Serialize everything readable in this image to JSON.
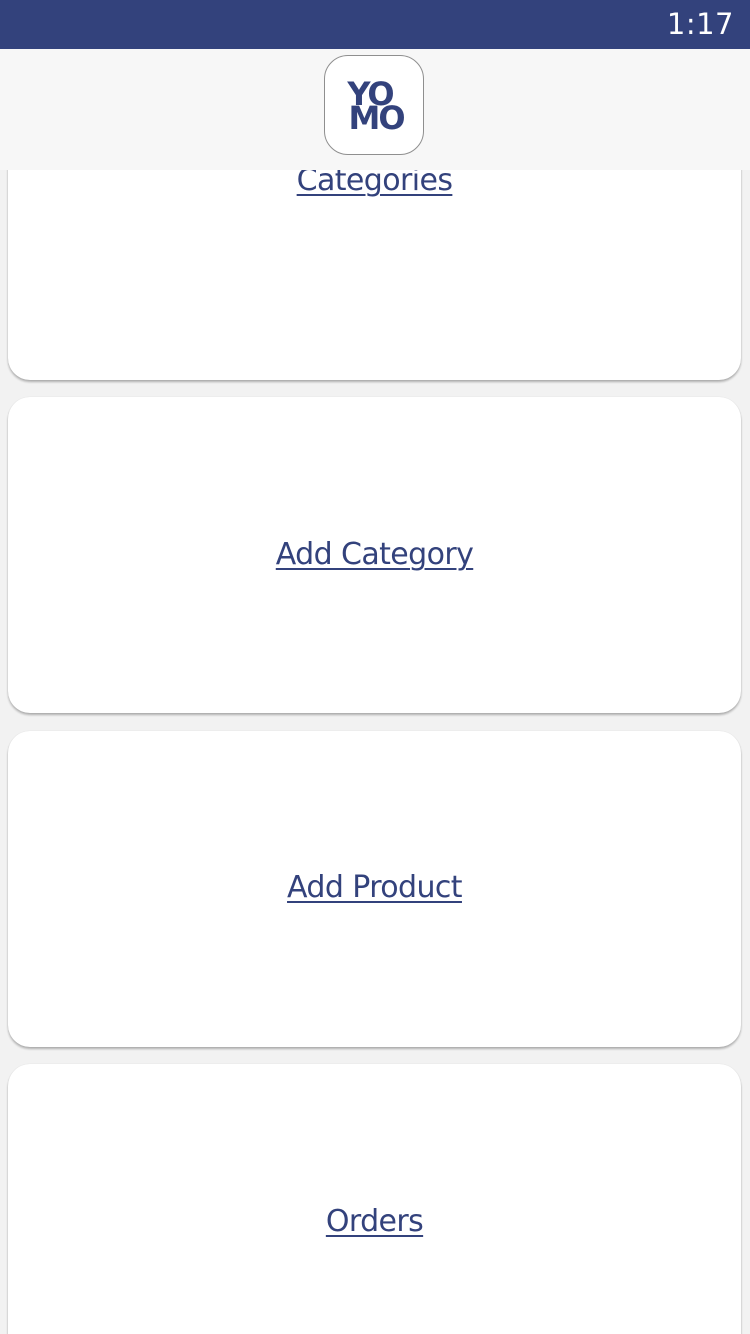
{
  "status_bar": {
    "time": "1:17",
    "background": "#33427c"
  },
  "header": {
    "logo": {
      "line1": "YO",
      "line2": "MO"
    }
  },
  "menu": {
    "items": [
      {
        "label": "Categories"
      },
      {
        "label": "Add Category"
      },
      {
        "label": "Add Product"
      },
      {
        "label": "Orders"
      }
    ]
  },
  "colors": {
    "accent": "#33427c",
    "card": "#ffffff",
    "background": "#f2f2f2"
  }
}
